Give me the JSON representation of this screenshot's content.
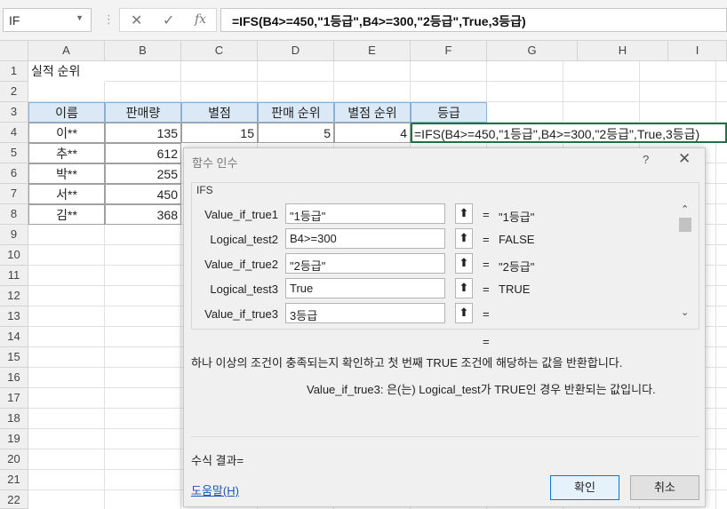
{
  "formula_bar": {
    "name_box": "IF",
    "cancel_icon": "✕",
    "enter_icon": "✓",
    "fx_icon": "fx",
    "formula": "=IFS(B4>=450,\"1등급\",B4>=300,\"2등급\",True,3등급)"
  },
  "columns": [
    "A",
    "B",
    "C",
    "D",
    "E",
    "F",
    "G",
    "H",
    "I"
  ],
  "rows": [
    "1",
    "2",
    "3",
    "4",
    "5",
    "6",
    "7",
    "8",
    "9",
    "10",
    "11",
    "12",
    "13",
    "14",
    "15",
    "16",
    "17",
    "18",
    "19",
    "20",
    "21",
    "22"
  ],
  "sheet": {
    "title": "실적 순위",
    "headers": [
      "이름",
      "판매량",
      "별점",
      "판매 순위",
      "별점 순위",
      "등급"
    ],
    "row4": {
      "name": "이**",
      "sales": "135",
      "stars": "15",
      "sales_rank": "5",
      "star_rank": "4",
      "grade_formula": "=IFS(B4>=450,\"1등급\",B4>=300,\"2등급\",True,3등급)"
    },
    "names": [
      "추**",
      "박**",
      "서**",
      "김**"
    ],
    "sales": [
      "612",
      "255",
      "450",
      "368"
    ]
  },
  "dialog": {
    "title": "함수 인수",
    "help_icon": "?",
    "close_icon": "✕",
    "function_name": "IFS",
    "args": [
      {
        "label": "Value_if_true1",
        "value": "\"1등급\"",
        "result": "\"1등급\""
      },
      {
        "label": "Logical_test2",
        "value": "B4>=300",
        "result": "FALSE"
      },
      {
        "label": "Value_if_true2",
        "value": "\"2등급\"",
        "result": "\"2등급\""
      },
      {
        "label": "Logical_test3",
        "value": "True",
        "result": "TRUE"
      },
      {
        "label": "Value_if_true3",
        "value": "3등급",
        "result": ""
      }
    ],
    "equals": "=",
    "description": "하나 이상의 조건이 충족되는지 확인하고 첫 번째 TRUE 조건에 해당하는 값을 반환합니다.",
    "arg_description": "Value_if_true3:  은(는) Logical_test가 TRUE인 경우 반환되는 값입니다.",
    "formula_result": "수식 결과=",
    "help_link": "도움말(H)",
    "ok": "확인",
    "cancel": "취소",
    "collapse_icon": "⬆",
    "scroll_up": "⌃",
    "scroll_down": "⌄"
  }
}
